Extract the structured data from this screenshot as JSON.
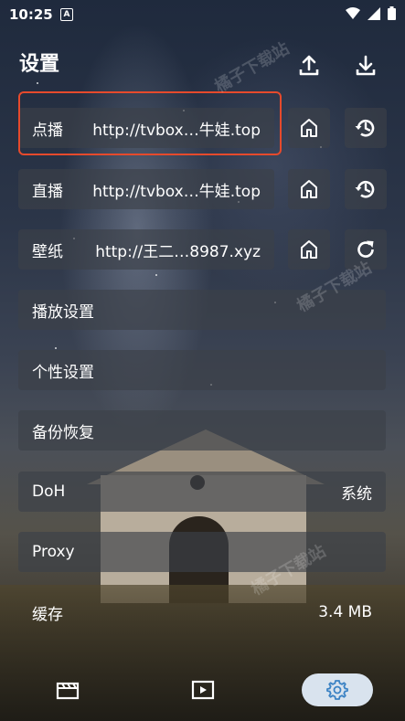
{
  "status": {
    "time": "10:25",
    "notif_letter": "A"
  },
  "header": {
    "title": "设置"
  },
  "rows": [
    {
      "label": "点播",
      "value": "http://tvbox…牛娃.top"
    },
    {
      "label": "直播",
      "value": "http://tvbox…牛娃.top"
    },
    {
      "label": "壁纸",
      "value": "http://王二…8987.xyz"
    }
  ],
  "menu": {
    "playback": "播放设置",
    "personal": "个性设置",
    "backup": "备份恢复",
    "doh_label": "DoH",
    "doh_value": "系统",
    "proxy": "Proxy",
    "cache_label": "缓存",
    "cache_value": "3.4 MB"
  },
  "watermark": "橘子下载站",
  "colors": {
    "highlight": "#e64a2c",
    "active_nav": "#d9e3ee",
    "active_icon": "#3b82c4"
  }
}
